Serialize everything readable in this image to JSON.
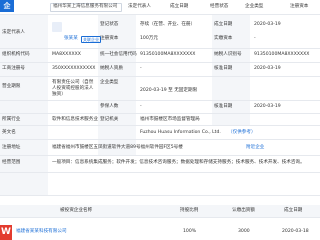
{
  "header": {
    "logo": "企",
    "company_name": "福州华某上海信息服务有限公司",
    "cols": [
      "企业名称",
      "法定代表人",
      "成立日期",
      "经营状态",
      "企业类型",
      "注册资本"
    ]
  },
  "row1": {
    "label": "法定代表人",
    "avatar_text": "陈",
    "name": "张某某",
    "badge": "关联企业",
    "col2_label": "登记状态",
    "col2_value": "存续（在营、开业、在册）",
    "col3_label": "成立日期",
    "col3_value": "2020-03-19"
  },
  "row2": {
    "col2_label": "注册资本",
    "col2_value": "100万元",
    "col3_label": "实缴资本",
    "col3_value": "-"
  },
  "row3": {
    "label": "组织机构代码",
    "value": "MA8XXXXXX",
    "col2_label": "统一社会信用代码",
    "col2_value": "91350100MA8XXXXXXX",
    "col3_label": "纳税人识别号",
    "col3_value": "91350100MA8XXXXXXX"
  },
  "row4": {
    "label": "工商注册号",
    "value": "350XXXXXXXXXXX",
    "col2_label": "纳税人资质",
    "col2_value": "-",
    "col3_label": "核准日期",
    "col3_value": "2020-03-19"
  },
  "row5": {
    "label": "营业期限",
    "value": "2020-03-19 至 无固定期限",
    "col2_label": "企业类型",
    "col2_value": "有限责任公司（自然人投资或控股的法人独资）",
    "col3_label": "",
    "col3_value": ""
  },
  "row6": {
    "col2_label": "参保人数",
    "col2_value": "-",
    "col3_label": "核准日期",
    "col3_value": "2020-03-19"
  },
  "row7": {
    "label": "所属行业",
    "value": "软件和信息技术服务业",
    "col2_label": "登记机关",
    "col2_value": "福州市鼓楼区市场监督管理局"
  },
  "row8": {
    "label": "英文名",
    "value": "Fuzhou Huasu Information Co., Ltd.",
    "link": "（仅供参考）"
  },
  "row9": {
    "label": "注册地址",
    "value": "福建省福州市鼓楼区五凤街道软件大道89号福州软件园F区5号楼",
    "link": "附近企业"
  },
  "row10": {
    "label": "经营范围",
    "value": "一般项目：信息系统集成服务；软件开发；信息技术咨询服务；数据处理和存储支持服务；技术服务、技术开发、技术咨询。"
  },
  "invest": {
    "cols": [
      "被投资企业名称",
      "持股比例",
      "认缴出资额",
      "成立日期"
    ],
    "logo": "W",
    "name": "福建省某某科技有限公司",
    "pct": "100%",
    "amount": "3000",
    "date": "2020-03-18"
  },
  "colors": {
    "accent": "#1a6dd6",
    "label_bg": "#f4f6f9",
    "logo_red": "#e33b2e"
  }
}
